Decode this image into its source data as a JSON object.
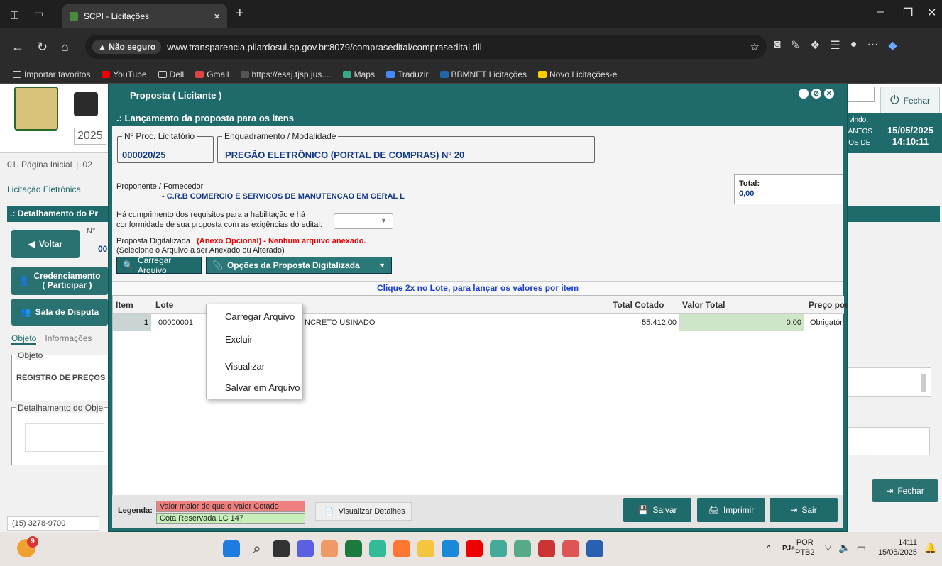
{
  "browser": {
    "tab_title": "SCPI - Licitações",
    "insecure_label": "Não seguro",
    "url": "www.transparencia.pilardosul.sp.gov.br:8079/comprasedital/comprasedital.dll",
    "bookmarks": [
      "Importar favoritos",
      "YouTube",
      "Dell",
      "Gmail",
      "https://esaj.tjsp.jus....",
      "Maps",
      "Traduzir",
      "BBMNET Licitações",
      "Novo Licitações-e"
    ]
  },
  "background": {
    "year": "2025",
    "nav_tabs": [
      "01. Página Inicial",
      "02"
    ],
    "breadcrumb": "Licitação Eletrônica",
    "section_title": ".: Detalhamento do Pr",
    "proc_fragment": "N°",
    "proc_fragment2": "00",
    "voltar": "Voltar",
    "credenciamento": "Credenciamento",
    "participar": "( Participar )",
    "sala": "Sala de Disputa",
    "tabs": [
      "Objeto",
      "Informações"
    ],
    "objeto_label": "Objeto",
    "objeto_text": "REGISTRO DE PREÇOS",
    "detalhamento_label": "Detalhamento do Obje",
    "phone": "(15) 3278-9700",
    "fechar_top": "Fechar",
    "welcome": [
      "n vindo,",
      "SANTOS",
      "COS DE"
    ],
    "date": "15/05/2025",
    "time": "14:10:11",
    "fechar_bottom": "Fechar"
  },
  "modal": {
    "title": "Proposta ( Licitante )",
    "section": ".: Lançamento da proposta para os itens",
    "proc_label": "Nº Proc. Licitatório",
    "proc_value": "000020/25",
    "enq_label": "Enquadramento / Modalidade",
    "enq_value": "PREGÃO ELETRÔNICO (PORTAL DE COMPRAS) Nº 20",
    "proponente_label": "Proponente / Fornecedor",
    "proponente_value": "-   C.R.B COMERCIO E SERVICOS DE MANUTENCAO EM GERAL L",
    "total_label": "Total:",
    "total_value": "0,00",
    "requisitos_line1": "Há cumprimento dos requisitos para a habilitação e há",
    "requisitos_line2": "conformidade de sua proposta com as exigências do edital:",
    "digital_label": "Proposta Digitalizada",
    "digital_status": "(Anexo Opcional) - Nenhum arquivo anexado.",
    "digital_hint": "(Selecione o Arquivo a ser Anexado ou Alterado)",
    "btn_carregar": "Carregar Arquivo",
    "btn_opcoes": "Opções da Proposta Digitalizada",
    "table_hint": "Clique 2x no Lote, para lançar os valores por item",
    "columns": [
      "Item",
      "Lote",
      "Total Cotado",
      "Valor Total",
      "Preço por"
    ],
    "row": {
      "item": "1",
      "lote": "00000001",
      "desc": "NCRETO USINADO",
      "total_cotado": "55.412,00",
      "valor_total": "0,00",
      "preco": "Obrigatór"
    },
    "menu": [
      "Carregar Arquivo",
      "Excluir",
      "Visualizar",
      "Salvar em Arquivo"
    ],
    "legend_label": "Legenda:",
    "legend_red": "Valor maior do que o Valor Cotado",
    "legend_green": "Cota Reservada LC 147",
    "btn_detalhes": "Visualizar Detalhes",
    "btn_salvar": "Salvar",
    "btn_imprimir": "Imprimir",
    "btn_sair": "Sair"
  },
  "taskbar": {
    "notif": "9",
    "lang1": "POR",
    "lang2": "PTB2",
    "time": "14:11",
    "date": "15/05/2025"
  }
}
